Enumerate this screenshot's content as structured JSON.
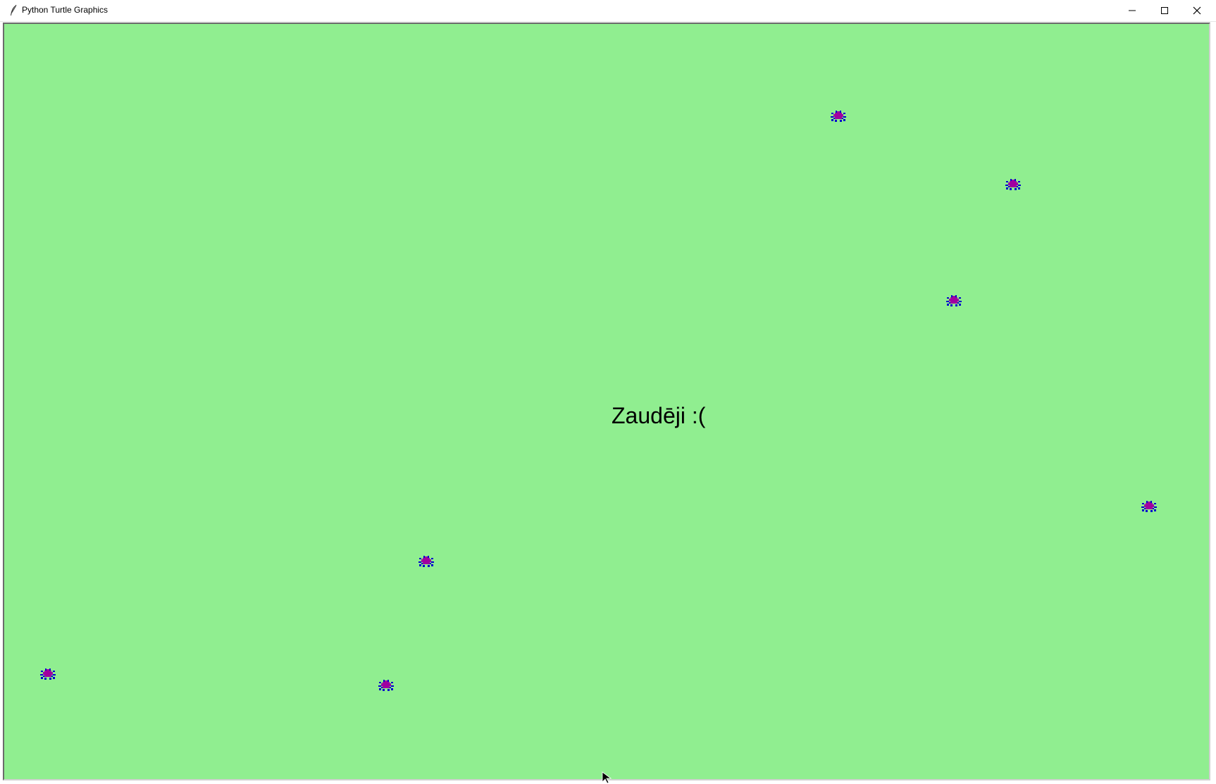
{
  "window": {
    "title": "Python Turtle Graphics",
    "minimize_icon": "minimize-icon",
    "maximize_icon": "maximize-icon",
    "close_icon": "close-icon",
    "app_icon": "feather-icon"
  },
  "canvas": {
    "background_color": "#90ee90",
    "message": "Zaudēji :(",
    "sprite_icon": "bug-icon",
    "sprite_colors": {
      "body": "#a000a0",
      "legs": "#0000cc"
    },
    "sprite_count": 7
  }
}
